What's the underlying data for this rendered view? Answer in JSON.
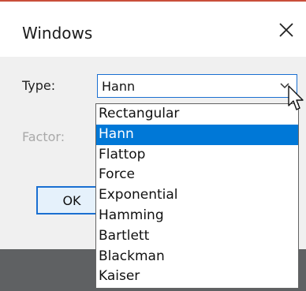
{
  "dialog": {
    "title": "Windows",
    "close_glyph": "✕",
    "type_label": "Type:",
    "factor_label": "Factor:",
    "ok_label": "OK",
    "type_select": {
      "value": "Hann"
    },
    "dropdown_options": [
      "Rectangular",
      "Hann",
      "Flattop",
      "Force",
      "Exponential",
      "Hamming",
      "Bartlett",
      "Blackman",
      "Kaiser"
    ],
    "selected_option": "Hann"
  },
  "icons": [
    "close-icon",
    "chevron-down-icon",
    "mouse-cursor-icon"
  ],
  "colors": {
    "accent": "#0078d7",
    "select_border": "#1a6fd1",
    "title_accent_line": "#c94f3b",
    "dialog_content_bg": "#f0f0f0",
    "backdrop": "#5f6163"
  }
}
